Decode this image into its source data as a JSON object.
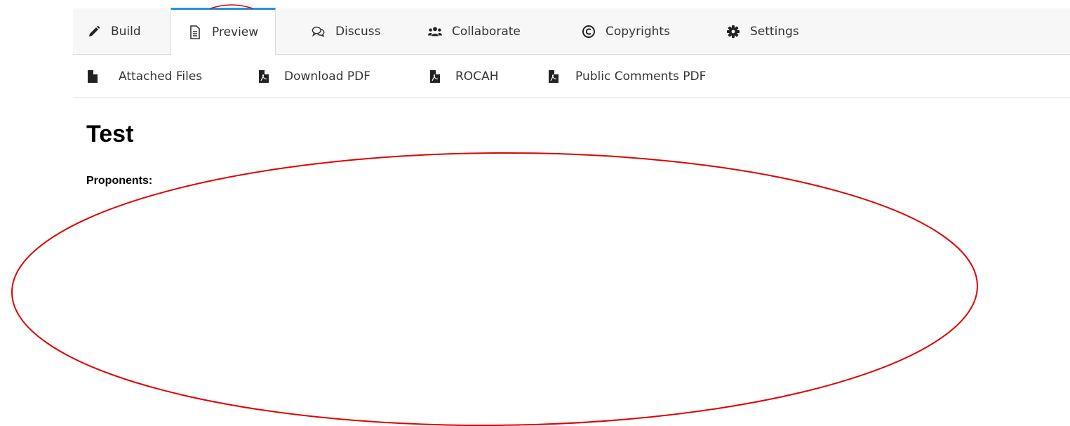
{
  "tabs": [
    {
      "label": "Build",
      "icon": "pencil-icon"
    },
    {
      "label": "Preview",
      "icon": "document-icon",
      "active": true
    },
    {
      "label": "Discuss",
      "icon": "speech-bubbles-icon"
    },
    {
      "label": "Collaborate",
      "icon": "users-icon"
    },
    {
      "label": "Copyrights",
      "icon": "copyright-icon"
    },
    {
      "label": "Settings",
      "icon": "gear-icon"
    }
  ],
  "subnav": [
    {
      "label": "Attached Files",
      "icon": "file-icon"
    },
    {
      "label": "Download PDF",
      "icon": "pdf-file-icon"
    },
    {
      "label": "ROCAH",
      "icon": "pdf-file-icon"
    },
    {
      "label": "Public Comments PDF",
      "icon": "pdf-file-icon"
    }
  ],
  "content": {
    "title": "Test",
    "proponents_label": "Proponents:"
  },
  "colors": {
    "active_tab_accent": "#2a8fd6",
    "annotation": "#e00000"
  }
}
